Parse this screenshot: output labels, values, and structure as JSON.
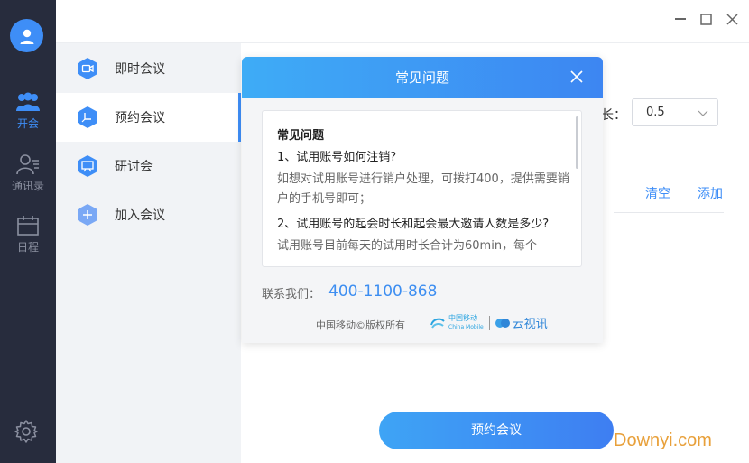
{
  "rail": {
    "items": [
      {
        "label": "开会",
        "icon": "people-icon"
      },
      {
        "label": "通讯录",
        "icon": "contacts-icon"
      },
      {
        "label": "日程",
        "icon": "calendar-icon"
      }
    ]
  },
  "submenu": {
    "items": [
      {
        "label": "即时会议",
        "icon": "video-camera-icon"
      },
      {
        "label": "预约会议",
        "icon": "clock-icon"
      },
      {
        "label": "研讨会",
        "icon": "presentation-icon"
      },
      {
        "label": "加入会议",
        "icon": "plus-icon"
      }
    ]
  },
  "main": {
    "duration_label": "长：",
    "duration_value": "0.5",
    "clear_label": "清空",
    "add_label": "添加",
    "submit_label": "预约会议"
  },
  "modal": {
    "title": "常见问题",
    "faq_heading": "常见问题",
    "faqs": [
      {
        "q": "1、试用账号如何注销?",
        "a": "如想对试用账号进行销户处理，可拨打400，提供需要销户的手机号即可；"
      },
      {
        "q": "2、试用账号的起会时长和起会最大邀请人数是多少?",
        "a": "试用账号目前每天的试用时长合计为60min，每个"
      }
    ],
    "contact_label": "联系我们：",
    "contact_number": "400-1100-868",
    "copyright": "中国移动©版权所有",
    "brand_cm": "中国移动",
    "brand_cm_en": "China Mobile",
    "brand_yun": "云视讯"
  },
  "watermark": "Downyi.com",
  "colors": {
    "accent": "#3e8ef7",
    "rail_bg": "#272c3d",
    "submenu_bg": "#f1f3f6",
    "hex_icon": "#3e8ef7"
  }
}
